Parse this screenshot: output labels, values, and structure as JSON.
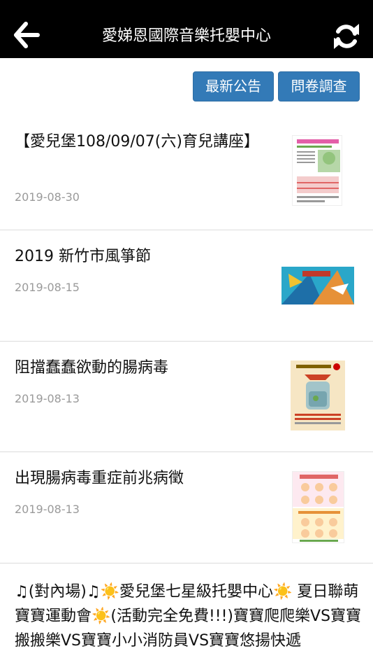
{
  "header": {
    "title": "愛娣恩國際音樂托嬰中心",
    "back_icon": "arrow-left-icon",
    "refresh_icon": "refresh-icon"
  },
  "actions": {
    "news_label": "最新公告",
    "survey_label": "問卷調查"
  },
  "posts": [
    {
      "title": "【愛兒堡108/09/07(六)育兒講座】",
      "date": "2019-08-30"
    },
    {
      "title": "2019 新竹市風箏節",
      "date": "2019-08-15"
    },
    {
      "title": "阻擋蠢蠢欲動的腸病毒",
      "date": "2019-08-13"
    },
    {
      "title": "出現腸病毒重症前兆病徵",
      "date": "2019-08-13"
    },
    {
      "title": "♫(對內場)♫☀️愛兒堡七星級托嬰中心☀️ 夏日聯萌寶寶運動會☀️(活動完全免費!!!)寶寶爬爬樂VS寶寶搬搬樂VS寶寶小小消防員VS寶寶悠揚快遞"
    }
  ],
  "colors": {
    "topbar": "#000000",
    "button": "#337ab7",
    "date": "#9a9a9a",
    "divider": "#dcdcdc"
  }
}
